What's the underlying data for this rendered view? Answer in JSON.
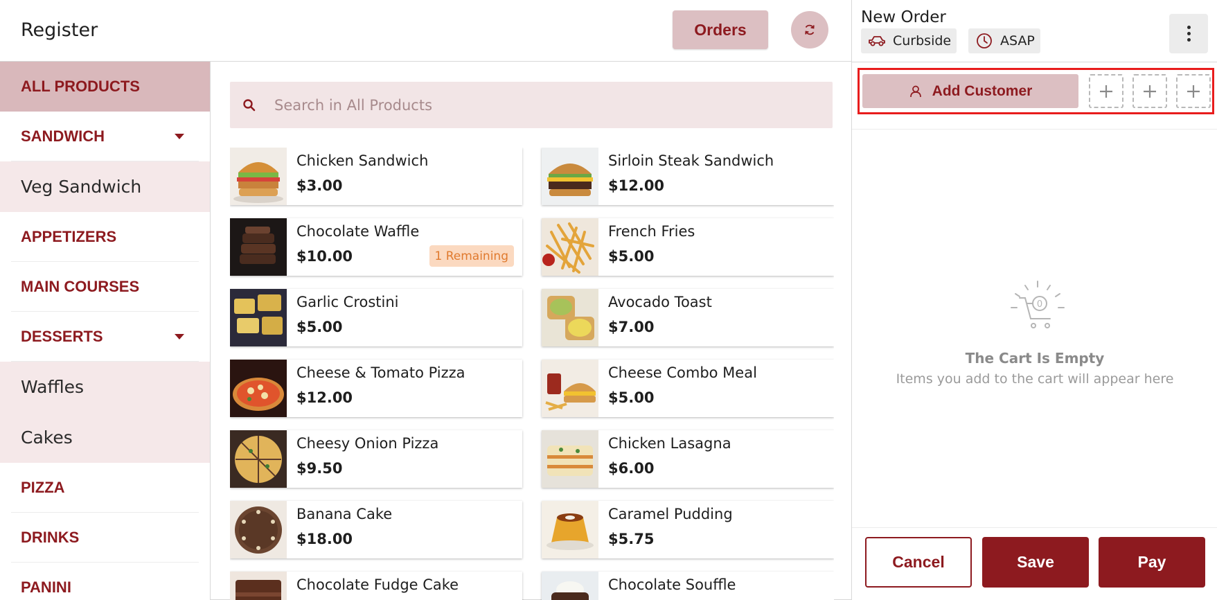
{
  "header": {
    "title": "Register",
    "orders_label": "Orders",
    "refresh_icon": "refresh-icon"
  },
  "sidebar": {
    "items": [
      {
        "label": "ALL PRODUCTS",
        "kind": "header",
        "active": true
      },
      {
        "label": "SANDWICH",
        "kind": "header",
        "expandable": true
      },
      {
        "label": "Veg Sandwich",
        "kind": "sub"
      },
      {
        "label": "APPETIZERS",
        "kind": "header"
      },
      {
        "label": "MAIN COURSES",
        "kind": "header"
      },
      {
        "label": "DESSERTS",
        "kind": "header",
        "expandable": true
      },
      {
        "label": "Waffles",
        "kind": "sub"
      },
      {
        "label": "Cakes",
        "kind": "sub"
      },
      {
        "label": "PIZZA",
        "kind": "header"
      },
      {
        "label": "DRINKS",
        "kind": "header"
      },
      {
        "label": "PANINI",
        "kind": "header"
      }
    ]
  },
  "search": {
    "placeholder": "Search in All Products"
  },
  "products": [
    {
      "name": "Chicken Sandwich",
      "price": "$3.00",
      "image": "chicken-sandwich-image"
    },
    {
      "name": "Sirloin Steak Sandwich",
      "price": "$12.00",
      "image": "steak-sandwich-image"
    },
    {
      "name": "Chocolate Waffle",
      "price": "$10.00",
      "badge": "1 Remaining",
      "image": "chocolate-waffle-image"
    },
    {
      "name": "French Fries",
      "price": "$5.00",
      "image": "french-fries-image"
    },
    {
      "name": "Garlic Crostini",
      "price": "$5.00",
      "image": "garlic-crostini-image"
    },
    {
      "name": "Avocado Toast",
      "price": "$7.00",
      "image": "avocado-toast-image"
    },
    {
      "name": "Cheese & Tomato Pizza",
      "price": "$12.00",
      "image": "pizza-image"
    },
    {
      "name": "Cheese Combo Meal",
      "price": "$5.00",
      "image": "combo-meal-image"
    },
    {
      "name": "Cheesy Onion Pizza",
      "price": "$9.50",
      "image": "onion-pizza-image"
    },
    {
      "name": "Chicken Lasagna",
      "price": "$6.00",
      "image": "lasagna-image"
    },
    {
      "name": "Banana Cake",
      "price": "$18.00",
      "image": "banana-cake-image"
    },
    {
      "name": "Caramel Pudding",
      "price": "$5.75",
      "image": "caramel-pudding-image"
    },
    {
      "name": "Chocolate Fudge Cake",
      "price": "",
      "image": "fudge-cake-image"
    },
    {
      "name": "Chocolate Souffle",
      "price": "",
      "image": "souffle-image"
    }
  ],
  "order": {
    "title": "New Order",
    "type_label": "Curbside",
    "time_label": "ASAP",
    "add_customer_label": "Add Customer",
    "empty_title": "The Cart Is Empty",
    "empty_subtitle": "Items you add to the cart will appear here",
    "cart_count": "0",
    "cancel_label": "Cancel",
    "save_label": "Save",
    "pay_label": "Pay"
  },
  "colors": {
    "brand": "#8d1a1f",
    "brand_light": "#dcbfc2",
    "highlight_border": "#e81c1c",
    "badge_bg": "#fbd9c0",
    "badge_text": "#e07a2e"
  }
}
